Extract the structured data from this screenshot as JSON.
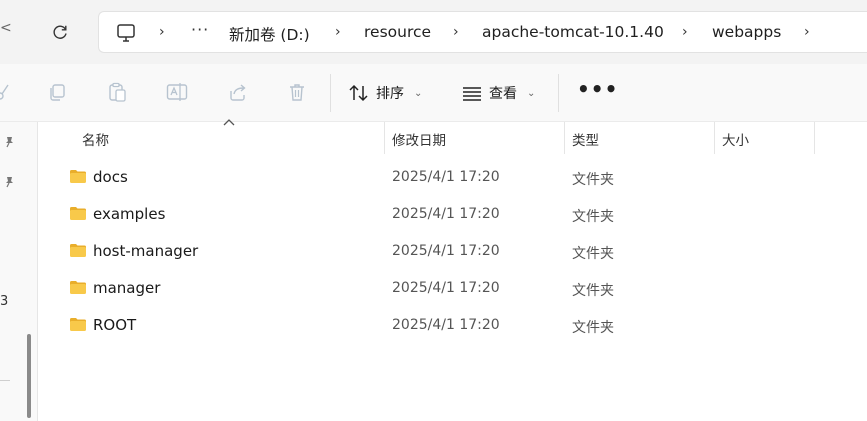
{
  "addressbar": {
    "left_fragment": "<",
    "crumbs": [
      "新加卷 (D:)",
      "resource",
      "apache-tomcat-10.1.40",
      "webapps"
    ],
    "overflow": "···"
  },
  "toolbar": {
    "sort_label": "排序",
    "view_label": "查看",
    "more_label": "•••",
    "icons": [
      "cut-icon",
      "copy-icon",
      "paste-icon",
      "rename-icon",
      "share-icon",
      "delete-icon"
    ]
  },
  "nav": {
    "fragment": "3"
  },
  "columns": {
    "name": "名称",
    "modified": "修改日期",
    "type": "类型",
    "size": "大小"
  },
  "files": [
    {
      "name": "docs",
      "modified": "2025/4/1 17:20",
      "type": "文件夹"
    },
    {
      "name": "examples",
      "modified": "2025/4/1 17:20",
      "type": "文件夹"
    },
    {
      "name": "host-manager",
      "modified": "2025/4/1 17:20",
      "type": "文件夹"
    },
    {
      "name": "manager",
      "modified": "2025/4/1 17:20",
      "type": "文件夹"
    },
    {
      "name": "ROOT",
      "modified": "2025/4/1 17:20",
      "type": "文件夹"
    }
  ],
  "colors": {
    "folder_body": "#F8C94A",
    "folder_tab": "#E9AE2B",
    "disabled_icon": "#b7c3cf"
  }
}
